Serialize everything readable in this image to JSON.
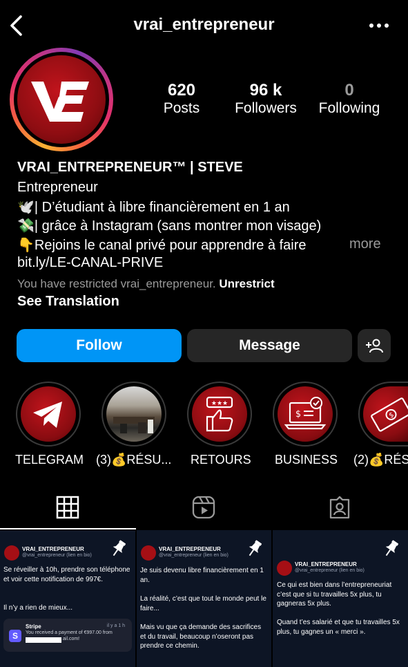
{
  "header": {
    "title": "vrai_entrepreneur",
    "back_icon": "chevron-left-icon",
    "more_icon": "more-horizontal-icon"
  },
  "profile": {
    "avatar_text": "VE",
    "stats": [
      {
        "value": "620",
        "label": "Posts"
      },
      {
        "value": "96 k",
        "label": "Followers"
      },
      {
        "value": "0",
        "label": "Following"
      }
    ],
    "name": "VRAI_ENTREPRENEUR™ | STEVE",
    "category": "Entrepreneur",
    "bio_lines": [
      {
        "emoji": "🕊️",
        "text": "| D’étudiant à libre financièrement en 1 an"
      },
      {
        "emoji": "💸",
        "text": "| grâce à Instagram (sans montrer mon visage)"
      },
      {
        "emoji": "👇",
        "text": "Rejoins le canal privé pour apprendre à faire"
      }
    ],
    "more_label": "more",
    "link": "bit.ly/LE-CANAL-PRIVE",
    "restricted_text": "You have restricted vrai_entrepreneur.",
    "unrestrict_label": "Unrestrict",
    "see_translation": "See Translation"
  },
  "actions": {
    "follow": "Follow",
    "message": "Message",
    "add_user_icon": "add-user-icon"
  },
  "highlights": [
    {
      "label": "TELEGRAM",
      "icon": "telegram-icon"
    },
    {
      "label": "(3)💰RÉSU...",
      "icon": "photo"
    },
    {
      "label": "RETOURS",
      "icon": "rating-thumb-icon"
    },
    {
      "label": "BUSINESS",
      "icon": "laptop-check-icon"
    },
    {
      "label": "(2)💰RÉS",
      "icon": "money-icon"
    }
  ],
  "tabs": [
    {
      "name": "grid",
      "icon": "grid-icon",
      "active": true
    },
    {
      "name": "reels",
      "icon": "reels-icon",
      "active": false
    },
    {
      "name": "tagged",
      "icon": "tagged-icon",
      "active": false
    }
  ],
  "posts": [
    {
      "author": "VRAI_ENTREPRENEUR",
      "sub": "@vrai_entrepreneur (lien en bio)",
      "paragraphs": [
        "Se réveiller à 10h, prendre son téléphone et voir cette notification de 997€.",
        "Il n’y a rien de mieux..."
      ],
      "notification": {
        "app": "Stripe",
        "time": "il y a 1 h",
        "text": "You received a payment of €997.00 from",
        "email_suffix": "ail.com!"
      }
    },
    {
      "author": "VRAI_ENTREPRENEUR",
      "sub": "@vrai_entrepreneur (lien en bio)",
      "paragraphs": [
        "Je suis devenu libre financièrement en 1 an.",
        "La réalité, c’est que tout le monde peut le faire...",
        "Mais vu que ça demande des sacrifices et du travail, beaucoup n’oseront pas prendre ce chemin."
      ]
    },
    {
      "author": "VRAI_ENTREPRENEUR",
      "sub": "@vrai_entrepreneur (lien en bio)",
      "paragraphs": [
        "Ce qui est bien dans l’entrepreneuriat c’est que si tu travailles 5x plus, tu gagneras 5x plus.",
        "Quand t’es salarié et que tu travailles 5x plus, tu gagnes un « merci »."
      ]
    }
  ],
  "colors": {
    "accent": "#0095f6",
    "brand_red": "#c0141c",
    "button_dark": "#262626",
    "post_bg": "#0d1525"
  }
}
